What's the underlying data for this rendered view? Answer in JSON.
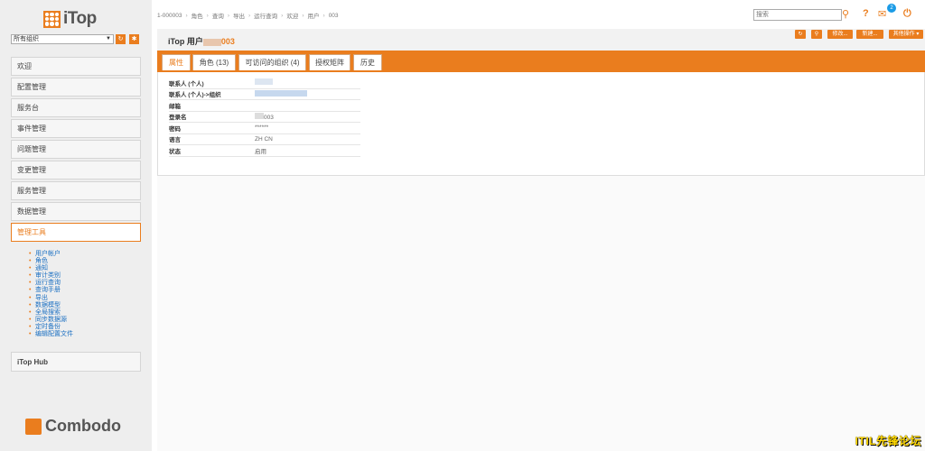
{
  "logo": {
    "text": "iTop"
  },
  "org_select": {
    "value": "所有组织"
  },
  "sidebar": {
    "items": [
      "欢迎",
      "配置管理",
      "服务台",
      "事件管理",
      "问题管理",
      "变更管理",
      "服务管理",
      "数据管理",
      "管理工具"
    ],
    "submenu": [
      "用户帐户",
      "角色",
      "通知",
      "审计类别",
      "运行查询",
      "查询手册",
      "导出",
      "数据模型",
      "全局搜索",
      "同步数据源",
      "定时备份",
      "编辑配置文件"
    ],
    "hub": "iTop Hub",
    "footer_logo": "Combodo"
  },
  "breadcrumb": [
    "1-000003",
    "角色",
    "查询",
    "导出",
    "运行查询",
    "欢迎",
    "用户",
    "003"
  ],
  "search": {
    "placeholder": "搜索"
  },
  "notifications": {
    "count": "2"
  },
  "header": {
    "title_prefix": "iTop 用户",
    "title_num": "003"
  },
  "actions": {
    "modify": "修改...",
    "new": "新建...",
    "other": "其他操作"
  },
  "tabs": [
    "属性",
    "角色 (13)",
    "可访问的组织 (4)",
    "授权矩阵",
    "历史"
  ],
  "properties": [
    {
      "label": "联系人 (个人)",
      "value": ""
    },
    {
      "label": "联系人 (个人)->组织",
      "value": ""
    },
    {
      "label": "邮箱",
      "value": ""
    },
    {
      "label": "登录名",
      "value": "003"
    },
    {
      "label": "密码",
      "value": "******"
    },
    {
      "label": "语言",
      "value": "ZH CN"
    },
    {
      "label": "状态",
      "value": "启用"
    }
  ],
  "watermark": "ITIL先锋论坛",
  "colors": {
    "accent": "#ea7d1e",
    "link": "#1a6fc2",
    "badge": "#1a9be6"
  }
}
